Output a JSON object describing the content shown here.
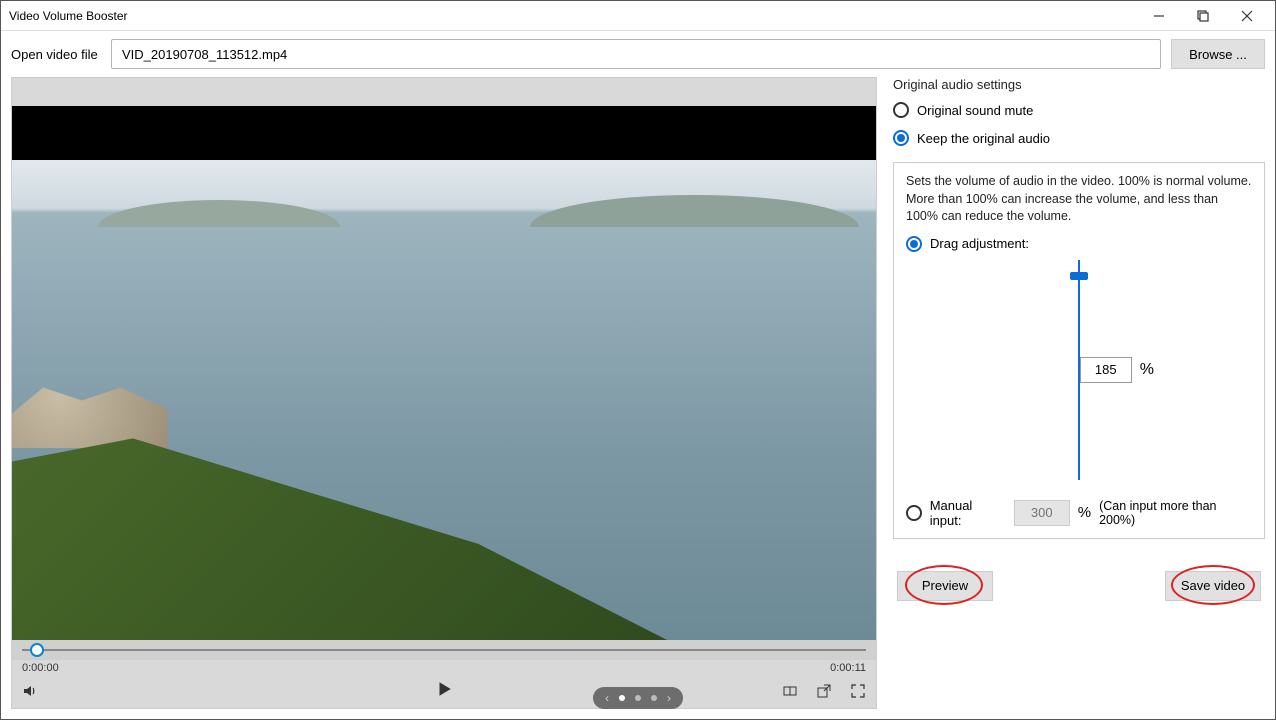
{
  "window": {
    "title": "Video Volume Booster"
  },
  "openFile": {
    "label": "Open video file",
    "value": "VID_20190708_113512.mp4",
    "browse": "Browse ..."
  },
  "player": {
    "currentTime": "0:00:00",
    "duration": "0:00:11"
  },
  "audioSettings": {
    "title": "Original audio settings",
    "muteLabel": "Original sound mute",
    "keepLabel": "Keep the original audio",
    "selected": "keep"
  },
  "volume": {
    "description": "Sets the volume of audio in the video. 100% is normal volume. More than 100% can increase the volume, and less than 100% can reduce the volume.",
    "dragLabel": "Drag adjustment:",
    "dragValue": "185",
    "percentSymbol": "%",
    "manualLabel": "Manual input:",
    "manualPlaceholder": "300",
    "manualHint": "(Can input more than 200%)",
    "mode": "drag"
  },
  "actions": {
    "preview": "Preview",
    "save": "Save video"
  }
}
